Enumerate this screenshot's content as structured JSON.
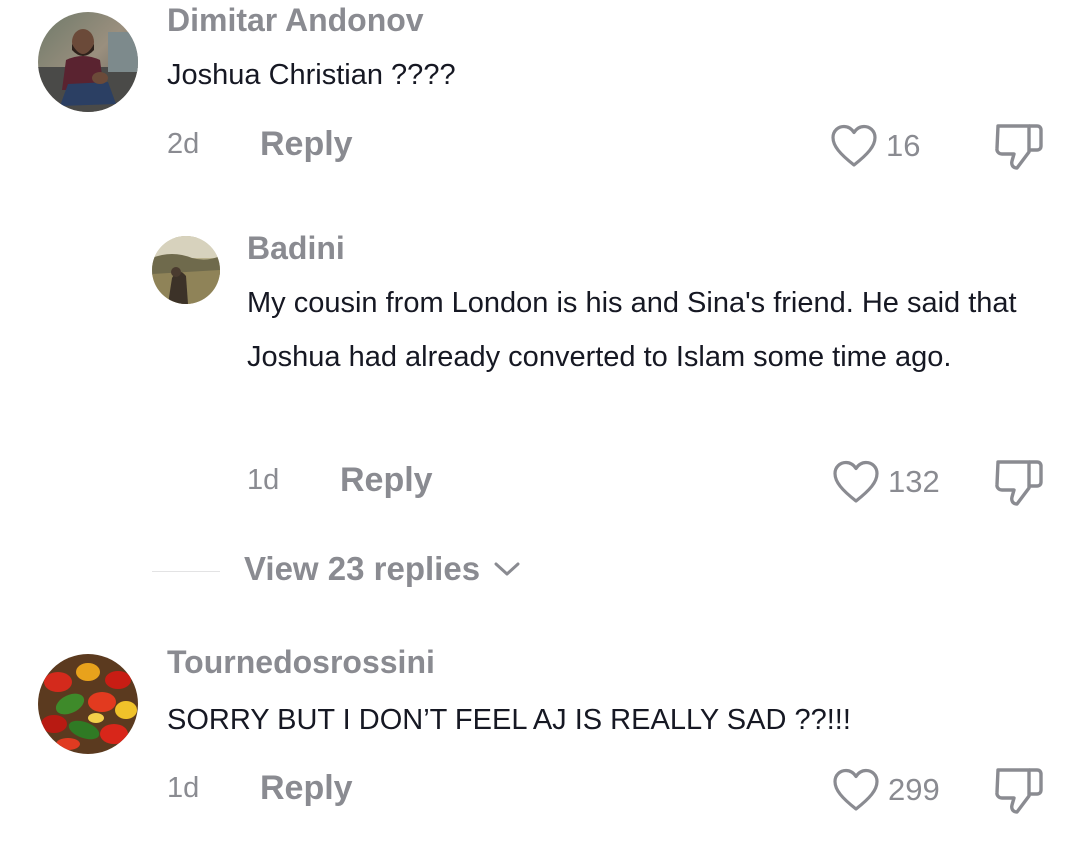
{
  "comments": [
    {
      "username": "Dimitar Andonov",
      "text": "Joshua Christian ????",
      "time": "2d",
      "reply_label": "Reply",
      "likes": "16",
      "avatar": "man-sitting-photo"
    },
    {
      "username": "Badini",
      "text": "My cousin from London is his and Sina's friend. He said that Joshua had already converted to Islam some time ago.",
      "time": "1d",
      "reply_label": "Reply",
      "likes": "132",
      "avatar": "landscape-photo"
    },
    {
      "username": "Tournedosrossini",
      "text": "SORRY BUT I DON’T FEEL AJ IS REALLY SAD ??!!!",
      "time": "1d",
      "reply_label": "Reply",
      "likes": "299",
      "avatar": "peppers-photo"
    }
  ],
  "view_replies": {
    "label": "View 23 replies",
    "icon": "chevron-down-icon"
  },
  "colors": {
    "muted": "#8a8b91",
    "text": "#161823",
    "background": "#ffffff"
  }
}
